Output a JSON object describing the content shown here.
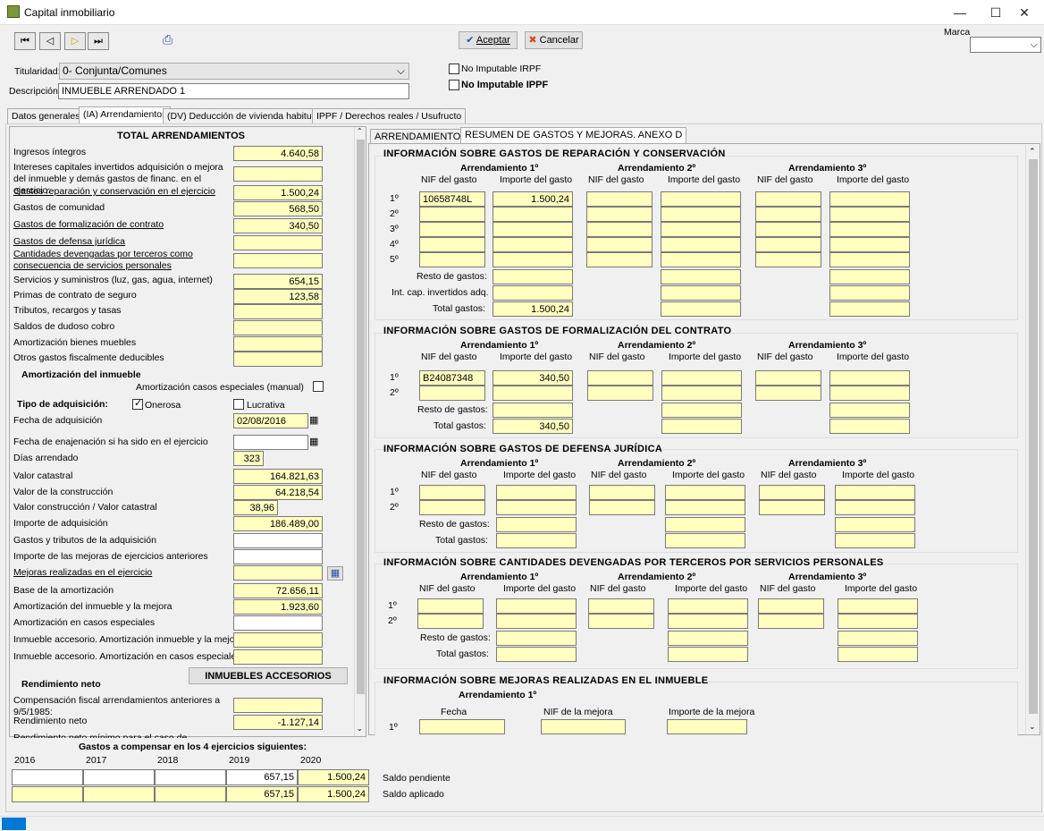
{
  "window": {
    "title": "Capital inmobiliario"
  },
  "toolbar": {
    "accept": "Aceptar",
    "cancel": "Cancelar",
    "marca_label": "Marca"
  },
  "header": {
    "titularidad_label": "Titularidad:",
    "titularidad_value": "0- Conjunta/Comunes",
    "descripcion_label": "Descripción:",
    "descripcion_value": "INMUEBLE ARRENDADO 1",
    "no_imputable_irpf": "No Imputable IRPF",
    "no_imputable_ippf": "No Imputable IPPF"
  },
  "tabs": [
    "Datos generales",
    "(IA) Arrendamientos",
    "(DV) Deducción de vivienda habitual",
    "IPPF / Derechos reales / Usufructo"
  ],
  "left": {
    "title": "TOTAL ARRENDAMIENTOS",
    "rows": [
      {
        "label": "Ingresos íntegros",
        "value": "4.640,58"
      },
      {
        "label": "Intereses capitales invertidos adquisición o mejora del inmueble y demás gastos de financ. en el ejercicio:",
        "value": ""
      },
      {
        "label": "Gastos reparación y conservación en el ejercicio",
        "value": "1.500,24"
      },
      {
        "label": "Gastos de comunidad",
        "value": "568,50"
      },
      {
        "label": "Gastos de formalización de contrato",
        "value": "340,50"
      },
      {
        "label": "Gastos de defensa jurídica",
        "value": ""
      },
      {
        "label": "Cantidades devengadas por terceros como consecuencia de servicios personales",
        "value": ""
      },
      {
        "label": "Servicios y suministros (luz, gas, agua, internet)",
        "value": "654,15"
      },
      {
        "label": "Primas de contrato de seguro",
        "value": "123,58"
      },
      {
        "label": "Tributos, recargos y tasas",
        "value": ""
      },
      {
        "label": "Saldos de dudoso cobro",
        "value": ""
      },
      {
        "label": "Amortización bienes muebles",
        "value": ""
      },
      {
        "label": "Otros gastos fiscalmente deducibles",
        "value": ""
      }
    ],
    "amort_title": "Amortización del inmueble",
    "amort_especiales": "Amortización casos especiales (manual)",
    "tipo_adq": "Tipo de adquisición:",
    "onerosa": "Onerosa",
    "lucrativa": "Lucrativa",
    "rows2": [
      {
        "label": "Fecha de adquisición",
        "value": "02/08/2016"
      },
      {
        "label": "Fecha de enajenación si ha sido en el ejercicio",
        "value": ""
      },
      {
        "label": "Días arrendado",
        "value": "323"
      },
      {
        "label": "Valor catastral",
        "value": "164.821,63"
      },
      {
        "label": "Valor de la construcción",
        "value": "64.218,54"
      },
      {
        "label": "Valor construcción / Valor catastral",
        "value": "38,96"
      },
      {
        "label": "Importe de adquisición",
        "value": "186.489,00"
      },
      {
        "label": "Gastos y tributos de la adquisición",
        "value": ""
      },
      {
        "label": "Importe de las mejoras de ejercicios anteriores",
        "value": ""
      },
      {
        "label": "Mejoras realizadas en el ejercicio",
        "value": ""
      },
      {
        "label": "Base de la amortización",
        "value": "72.656,11"
      },
      {
        "label": "Amortización del inmueble y la mejora",
        "value": "1.923,60"
      },
      {
        "label": "Amortización en casos especiales",
        "value": ""
      },
      {
        "label": "Inmueble accesorio. Amortización inmueble y la mejora",
        "value": ""
      },
      {
        "label": "Inmueble accesorio. Amortización en casos especiales",
        "value": ""
      }
    ],
    "accesorios_btn": "INMUEBLES ACCESORIOS",
    "rend_title": "Rendimiento neto",
    "rows3": [
      {
        "label": "Compensación fiscal arrendamientos anteriores a 9/5/1985:",
        "value": ""
      },
      {
        "label": "Rendimiento neto",
        "value": "-1.127,14"
      },
      {
        "label": "Rendimiento neto mínimo para el caso de arrendamiento",
        "value": ""
      }
    ]
  },
  "bottom": {
    "title": "Gastos a compensar en los 4 ejercicios siguientes:",
    "years": [
      "2016",
      "2017",
      "2018",
      "2019",
      "2020"
    ],
    "pendiente": [
      "",
      "",
      "",
      "657,15",
      "1.500,24"
    ],
    "aplicado": [
      "",
      "",
      "",
      "657,15",
      "1.500,24"
    ],
    "pendiente_label": "Saldo pendiente",
    "aplicado_label": "Saldo aplicado"
  },
  "right": {
    "subtabs": [
      "ARRENDAMIENTOS",
      "RESUMEN DE GASTOS Y MEJORAS. ANEXO D"
    ],
    "arr": [
      "Arrendamiento 1º",
      "Arrendamiento 2º",
      "Arrendamiento 3º"
    ],
    "nif": "NIF del gasto",
    "importe": "Importe del gasto",
    "resto": "Resto de gastos:",
    "intcap": "Int. cap. invertidos adq.",
    "total": "Total gastos:",
    "rows": [
      "1º",
      "2º",
      "3º",
      "4º",
      "5º"
    ],
    "s1": {
      "title": "INFORMACIÓN SOBRE GASTOS DE REPARACIÓN Y CONSERVACIÓN",
      "nif1": "10658748L",
      "imp1": "1.500,24",
      "total1": "1.500,24"
    },
    "s2": {
      "title": "INFORMACIÓN SOBRE GASTOS DE FORMALIZACIÓN DEL CONTRATO",
      "nif1": "B24087348",
      "imp1": "340,50",
      "total1": "340,50"
    },
    "s3": {
      "title": "INFORMACIÓN SOBRE GASTOS DE DEFENSA JURÍDICA"
    },
    "s4": {
      "title": "INFORMACIÓN SOBRE CANTIDADES DEVENGADAS POR TERCEROS POR SERVICIOS PERSONALES"
    },
    "s5": {
      "title": "INFORMACIÓN SOBRE MEJORAS REALIZADAS EN EL INMUEBLE",
      "fecha": "Fecha",
      "nif_mejora": "NIF de la mejora",
      "importe_mejora": "Importe de la mejora"
    }
  }
}
